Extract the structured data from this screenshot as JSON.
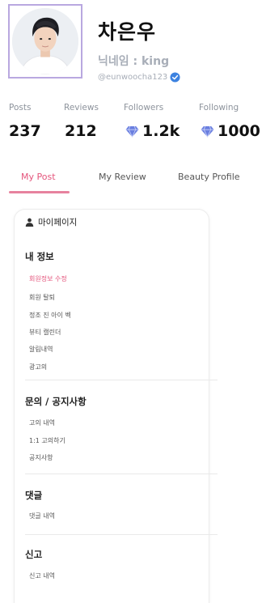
{
  "profile": {
    "name": "차은우",
    "nickname": "닉네임 : king",
    "handle": "@eunwoocha123"
  },
  "stats": {
    "posts_label": "Posts",
    "posts_value": "237",
    "reviews_label": "Reviews",
    "reviews_value": "212",
    "followers_label": "Followers",
    "followers_value": "1.2k",
    "following_label": "Following",
    "following_value": "1000"
  },
  "tabs": {
    "my_post": "My Post",
    "my_review": "My Review",
    "beauty_profile": "Beauty Profile",
    "active": "My Post"
  },
  "menu": {
    "title": "마이페이지",
    "sections": [
      {
        "title": "내 정보",
        "items": [
          "회원정보 수정",
          "회원 탈퇴",
          "정조 진 아이 벡",
          "뷰티 캘린더",
          "알림내역",
          "광고의"
        ]
      },
      {
        "title": "문의 / 공지사항",
        "items": [
          "고의 내역",
          "1:1 고의하기",
          "공지사항"
        ]
      },
      {
        "title": "댓글",
        "items": [
          "댓글 내역"
        ]
      },
      {
        "title": "신고",
        "items": [
          "신고 내역"
        ]
      }
    ]
  },
  "colors": {
    "accent": "#e4557c",
    "avatar_border": "#b9a8e0",
    "gem": "#6a7fe0",
    "verified": "#3d82e0",
    "muted_text": "#a8aeb8"
  },
  "icons": {
    "verified": "verified-check-icon",
    "gem": "diamond-gem-icon",
    "menu_header": "person-icon"
  }
}
